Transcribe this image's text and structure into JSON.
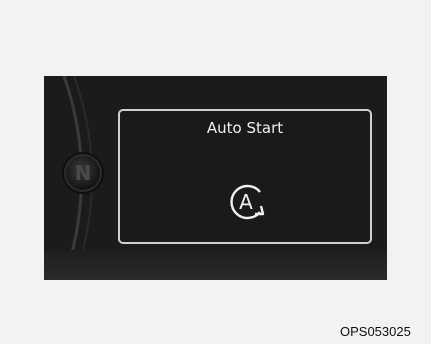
{
  "cluster": {
    "gear_indicator": "N",
    "display": {
      "title": "Auto Start",
      "icon": "auto-start-icon",
      "icon_letter": "A"
    }
  },
  "caption": "OPS053025"
}
